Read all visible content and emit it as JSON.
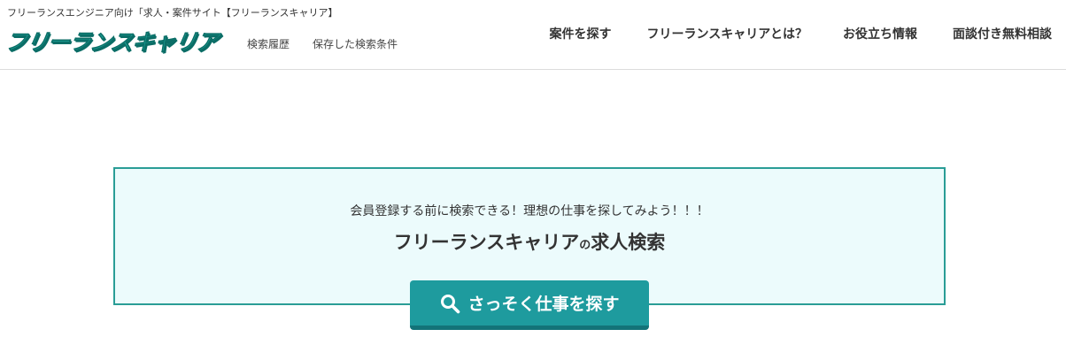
{
  "header": {
    "tagline": "フリーランスエンジニア向け「求人・案件サイト【フリーランスキャリア】",
    "logo_text": "フリーランスキャリア",
    "sublinks": [
      {
        "label": "検索履歴"
      },
      {
        "label": "保存した検索条件"
      }
    ],
    "nav": [
      {
        "label": "案件を探す"
      },
      {
        "label": "フリーランスキャリアとは？"
      },
      {
        "label": "お役立ち情報"
      },
      {
        "label": "面談付き無料相談"
      }
    ]
  },
  "search_panel": {
    "lead": "会員登録する前に検索できる！理想の仕事を探してみよう！！！",
    "heading_main": "フリーランスキャリア",
    "heading_particle": "の",
    "heading_tail": "求人検索",
    "button_label": "さっそく仕事を探す",
    "button_icon": "search-icon"
  },
  "colors": {
    "accent": "#1e9b9e",
    "panel_bg": "#ecfbfc",
    "panel_border": "#2a9d96",
    "logo": "#1fa59a"
  }
}
